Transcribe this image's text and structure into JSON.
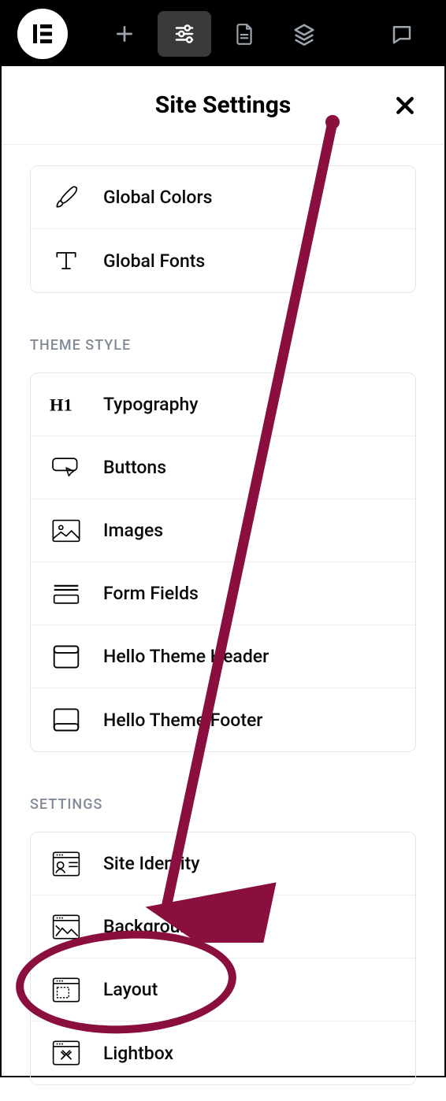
{
  "topbar": {
    "logo": "E",
    "icons": [
      "plus-icon",
      "sliders-icon",
      "document-icon",
      "layers-icon",
      "comment-icon"
    ]
  },
  "panel": {
    "title": "Site Settings"
  },
  "design_system": {
    "items": [
      {
        "label": "Global Colors",
        "icon": "brush-icon"
      },
      {
        "label": "Global Fonts",
        "icon": "typography-t-icon"
      }
    ]
  },
  "theme_style": {
    "heading": "THEME STYLE",
    "items": [
      {
        "label": "Typography",
        "icon": "h1-icon"
      },
      {
        "label": "Buttons",
        "icon": "button-cursor-icon"
      },
      {
        "label": "Images",
        "icon": "image-icon"
      },
      {
        "label": "Form Fields",
        "icon": "form-fields-icon"
      },
      {
        "label": "Hello Theme Header",
        "icon": "header-icon"
      },
      {
        "label": "Hello Theme Footer",
        "icon": "footer-icon"
      }
    ]
  },
  "settings": {
    "heading": "SETTINGS",
    "items": [
      {
        "label": "Site Identity",
        "icon": "identity-icon"
      },
      {
        "label": "Background",
        "icon": "background-icon"
      },
      {
        "label": "Layout",
        "icon": "layout-icon"
      },
      {
        "label": "Lightbox",
        "icon": "lightbox-icon"
      }
    ]
  },
  "annotation": {
    "color": "#8a0e3e"
  }
}
